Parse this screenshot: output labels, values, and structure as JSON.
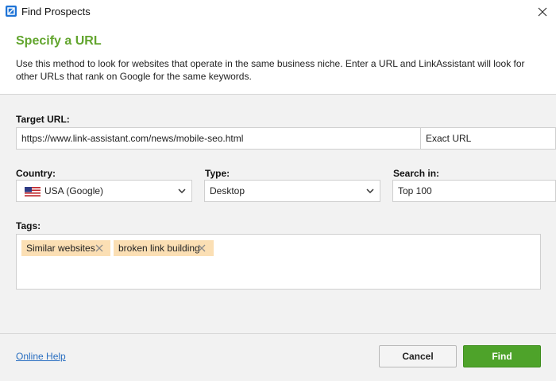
{
  "window": {
    "title": "Find Prospects"
  },
  "header": {
    "heading": "Specify a URL",
    "description": "Use this method to look for websites that operate in the same business niche. Enter a URL and LinkAssistant will look for other URLs that rank on Google for the same keywords."
  },
  "form": {
    "target_url": {
      "label": "Target URL:",
      "value": "https://www.link-assistant.com/news/mobile-seo.html",
      "mode": "Exact URL"
    },
    "country": {
      "label": "Country:",
      "value": "USA (Google)"
    },
    "type": {
      "label": "Type:",
      "value": "Desktop"
    },
    "search_in": {
      "label": "Search in:",
      "value": "Top 100"
    },
    "tags": {
      "label": "Tags:",
      "items": [
        "Similar websites",
        "broken link building"
      ]
    }
  },
  "footer": {
    "help": "Online Help",
    "cancel": "Cancel",
    "find": "Find"
  },
  "colors": {
    "accent_green": "#62a52e",
    "button_green": "#4ea32a",
    "tag_bg": "#fbdfb4",
    "link_blue": "#2a6fc1"
  },
  "icons": {
    "app": "link-assistant-app-icon",
    "close": "close-icon",
    "dropdown": "chevron-down-icon",
    "tag_remove": "remove-tag-icon",
    "flag": "us-flag-icon"
  }
}
